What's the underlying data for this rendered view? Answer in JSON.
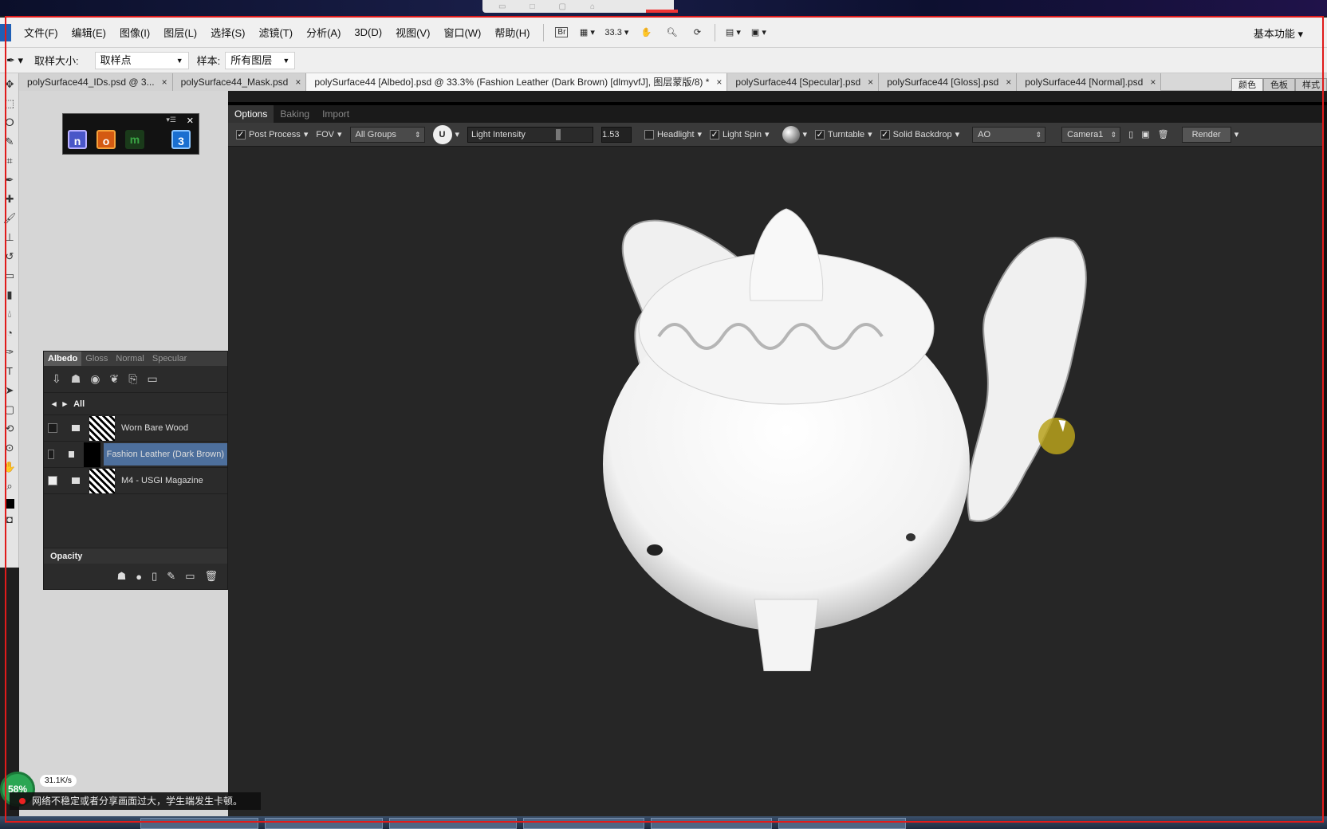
{
  "menubar": {
    "items": [
      "文件(F)",
      "编辑(E)",
      "图像(I)",
      "图层(L)",
      "选择(S)",
      "滤镜(T)",
      "分析(A)",
      "3D(D)",
      "视图(V)",
      "窗口(W)",
      "帮助(H)"
    ],
    "bridge_label": "Br",
    "zoom": "33.3",
    "workspace": "基本功能"
  },
  "optbar": {
    "sample_size_label": "取样大小:",
    "sample_size_value": "取样点",
    "sample_label": "样本:",
    "sample_value": "所有图层"
  },
  "tabs": [
    {
      "label": "polySurface44_IDs.psd @ 3...",
      "active": false
    },
    {
      "label": "polySurface44_Mask.psd",
      "active": false
    },
    {
      "label": "polySurface44 [Albedo].psd @ 33.3% (Fashion Leather (Dark Brown) [dlmyvfJ], 图层蒙版/8) *",
      "active": true
    },
    {
      "label": "polySurface44 [Specular].psd",
      "active": false
    },
    {
      "label": "polySurface44 [Gloss].psd",
      "active": false
    },
    {
      "label": "polySurface44 [Normal].psd",
      "active": false
    }
  ],
  "panel_tabs": [
    "颜色",
    "色板",
    "样式"
  ],
  "layers_panel": {
    "tabs": [
      "Albedo",
      "Gloss",
      "Normal",
      "Specular"
    ],
    "crumb": "All",
    "rows": [
      {
        "name": "Worn Bare Wood",
        "checked": false,
        "selected": false
      },
      {
        "name": "Fashion Leather (Dark Brown)",
        "checked": false,
        "selected": true
      },
      {
        "name": "M4 - USGI Magazine",
        "checked": true,
        "selected": false
      }
    ],
    "opacity_label": "Opacity"
  },
  "viewer": {
    "subtabs": [
      "Options",
      "Baking",
      "Import"
    ],
    "post_process": "Post Process",
    "fov": "FOV",
    "groups": "All Groups",
    "light_intensity_label": "Light Intensity",
    "light_intensity_value": "1.53",
    "headlight": "Headlight",
    "light_spin": "Light Spin",
    "turntable": "Turntable",
    "solid_backdrop": "Solid Backdrop",
    "channel": "AO",
    "camera": "Camera1",
    "render": "Render"
  },
  "plugin_icons": [
    "n",
    "o",
    "m",
    "3"
  ],
  "netstat": {
    "percent": "58%",
    "speed": "31.1K/s"
  },
  "banner": "网络不稳定或者分享画面过大，学生端发生卡顿。"
}
